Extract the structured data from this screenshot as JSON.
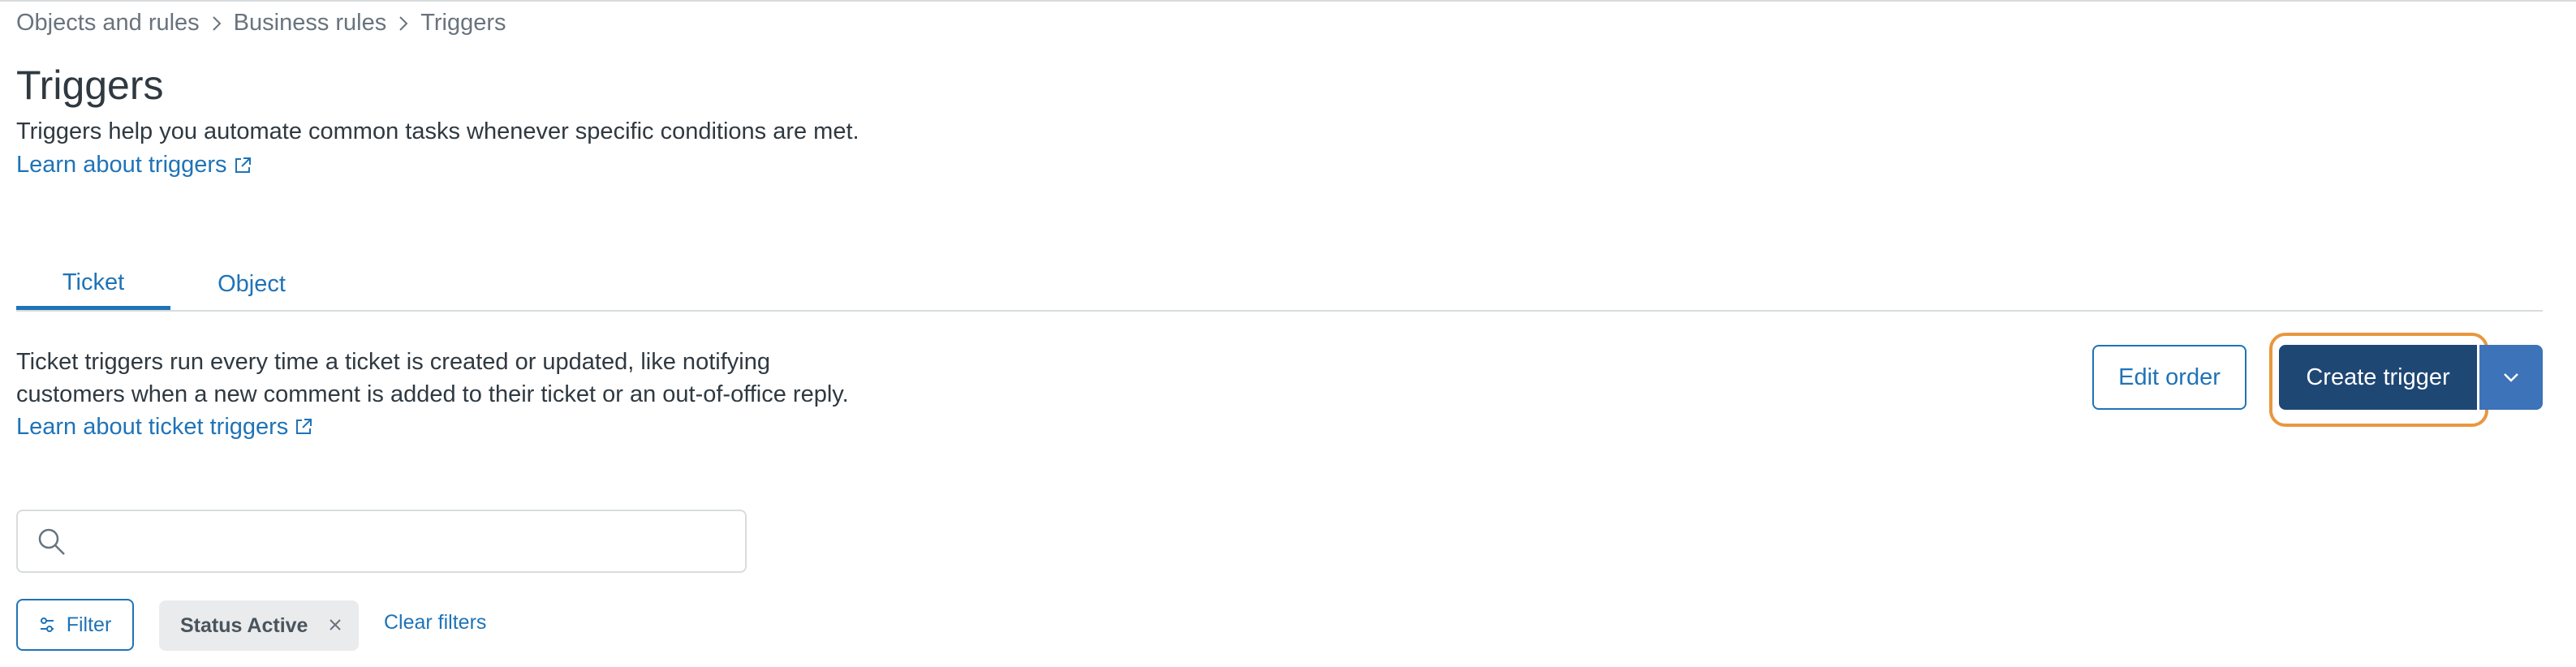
{
  "breadcrumb": {
    "items": [
      "Objects and rules",
      "Business rules",
      "Triggers"
    ]
  },
  "header": {
    "title": "Triggers",
    "description": "Triggers help you automate common tasks whenever specific conditions are met.",
    "learn_link": "Learn about triggers"
  },
  "tabs": [
    {
      "label": "Ticket",
      "selected": true
    },
    {
      "label": "Object",
      "selected": false
    }
  ],
  "ticket_section": {
    "description_line1": "Ticket triggers run every time a ticket is created or updated, like notifying",
    "description_line2": "customers when a new comment is added to their ticket or an out-of-office reply.",
    "learn_link": "Learn about ticket triggers"
  },
  "actions": {
    "edit_order_label": "Edit order",
    "create_trigger_label": "Create trigger"
  },
  "search": {
    "placeholder": "",
    "value": ""
  },
  "filters": {
    "filter_label": "Filter",
    "active_tag": "Status Active",
    "clear_label": "Clear filters"
  },
  "icons": {
    "breadcrumb_separator": "chevron-right-icon",
    "external_link": "external-link-icon",
    "search": "search-icon",
    "dropdown": "chevron-down-icon",
    "filter": "filter-sliders-icon",
    "remove_tag": "close-icon"
  },
  "colors": {
    "link": "#1f73b7",
    "primary_button": "#1f4774",
    "split_button": "#3d73b8",
    "highlight_outline": "#e8973e",
    "tag_background": "#e9ebed",
    "text": "#2f3941",
    "muted_text": "#68737d"
  }
}
